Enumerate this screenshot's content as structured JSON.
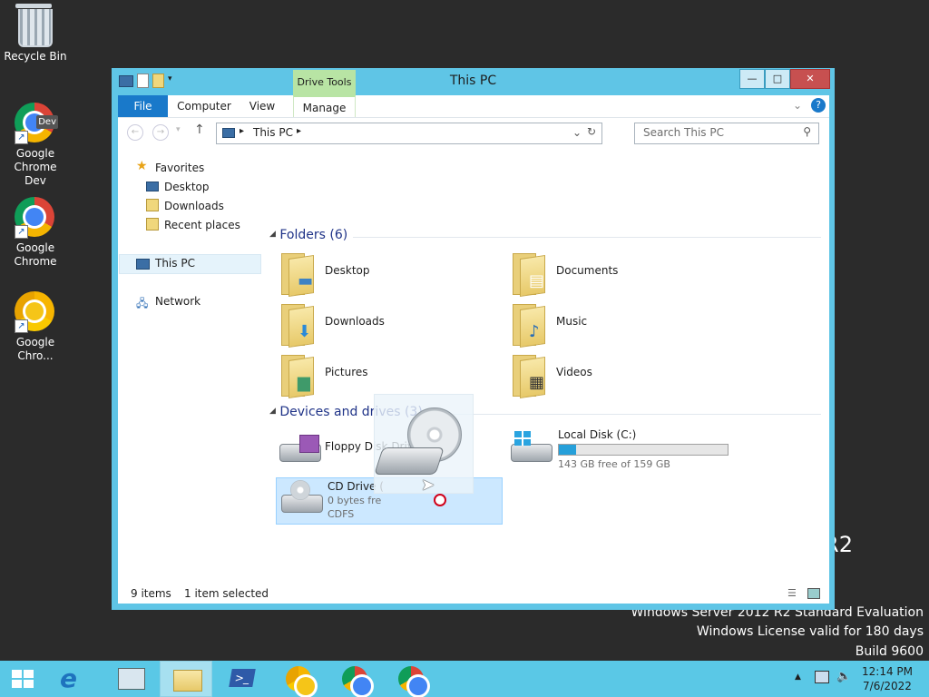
{
  "desktop": {
    "icons": [
      {
        "label": "Recycle Bin",
        "icon": "recycle-bin-icon"
      },
      {
        "label": "Google Chrome Dev",
        "icon": "chrome-dev-icon",
        "badge": "Dev"
      },
      {
        "label": "Google Chrome",
        "icon": "chrome-icon"
      },
      {
        "label": "Google Chro...",
        "icon": "chrome-canary-icon"
      }
    ],
    "watermark": {
      "fragment": "R2",
      "edition": "Windows Server 2012 R2 Standard Evaluation",
      "license": "Windows License valid for 180 days",
      "build": "Build 9600"
    }
  },
  "window": {
    "title": "This PC",
    "contextual_tab_group": "Drive Tools",
    "controls": {
      "minimize": "—",
      "maximize": "□",
      "close": "✕"
    },
    "ribbon_tabs": [
      {
        "label": "File"
      },
      {
        "label": "Computer"
      },
      {
        "label": "View"
      },
      {
        "label": "Manage"
      }
    ],
    "address": {
      "location": "This PC",
      "separator": "▸"
    },
    "search": {
      "placeholder": "Search This PC"
    },
    "nav": {
      "favorites": "Favorites",
      "favorites_items": [
        "Desktop",
        "Downloads",
        "Recent places"
      ],
      "this_pc": "This PC",
      "network": "Network"
    },
    "folders": {
      "header": "Folders (6)",
      "items": [
        "Desktop",
        "Documents",
        "Downloads",
        "Music",
        "Pictures",
        "Videos"
      ]
    },
    "devices": {
      "header": "Devices and drives (3)",
      "floppy": {
        "label": "Floppy Disk Drive (A:)"
      },
      "local_disk": {
        "label": "Local Disk (C:)",
        "free_text": "143 GB free of 159 GB",
        "used_fraction": 0.1
      },
      "cd_drive": {
        "label": "CD Drive (",
        "size_text": "0 bytes fre",
        "fs": "CDFS"
      }
    },
    "status": {
      "items": "9 items",
      "selected": "1 item selected"
    }
  },
  "taskbar": {
    "time": "12:14 PM",
    "date": "7/6/2022"
  },
  "colors": {
    "window_frame": "#5fc5e6",
    "file_tab": "#1979ca",
    "drive_tools": "#b8e4a4",
    "taskbar": "#5ac8e6",
    "disk_fill": "#26a0da"
  }
}
